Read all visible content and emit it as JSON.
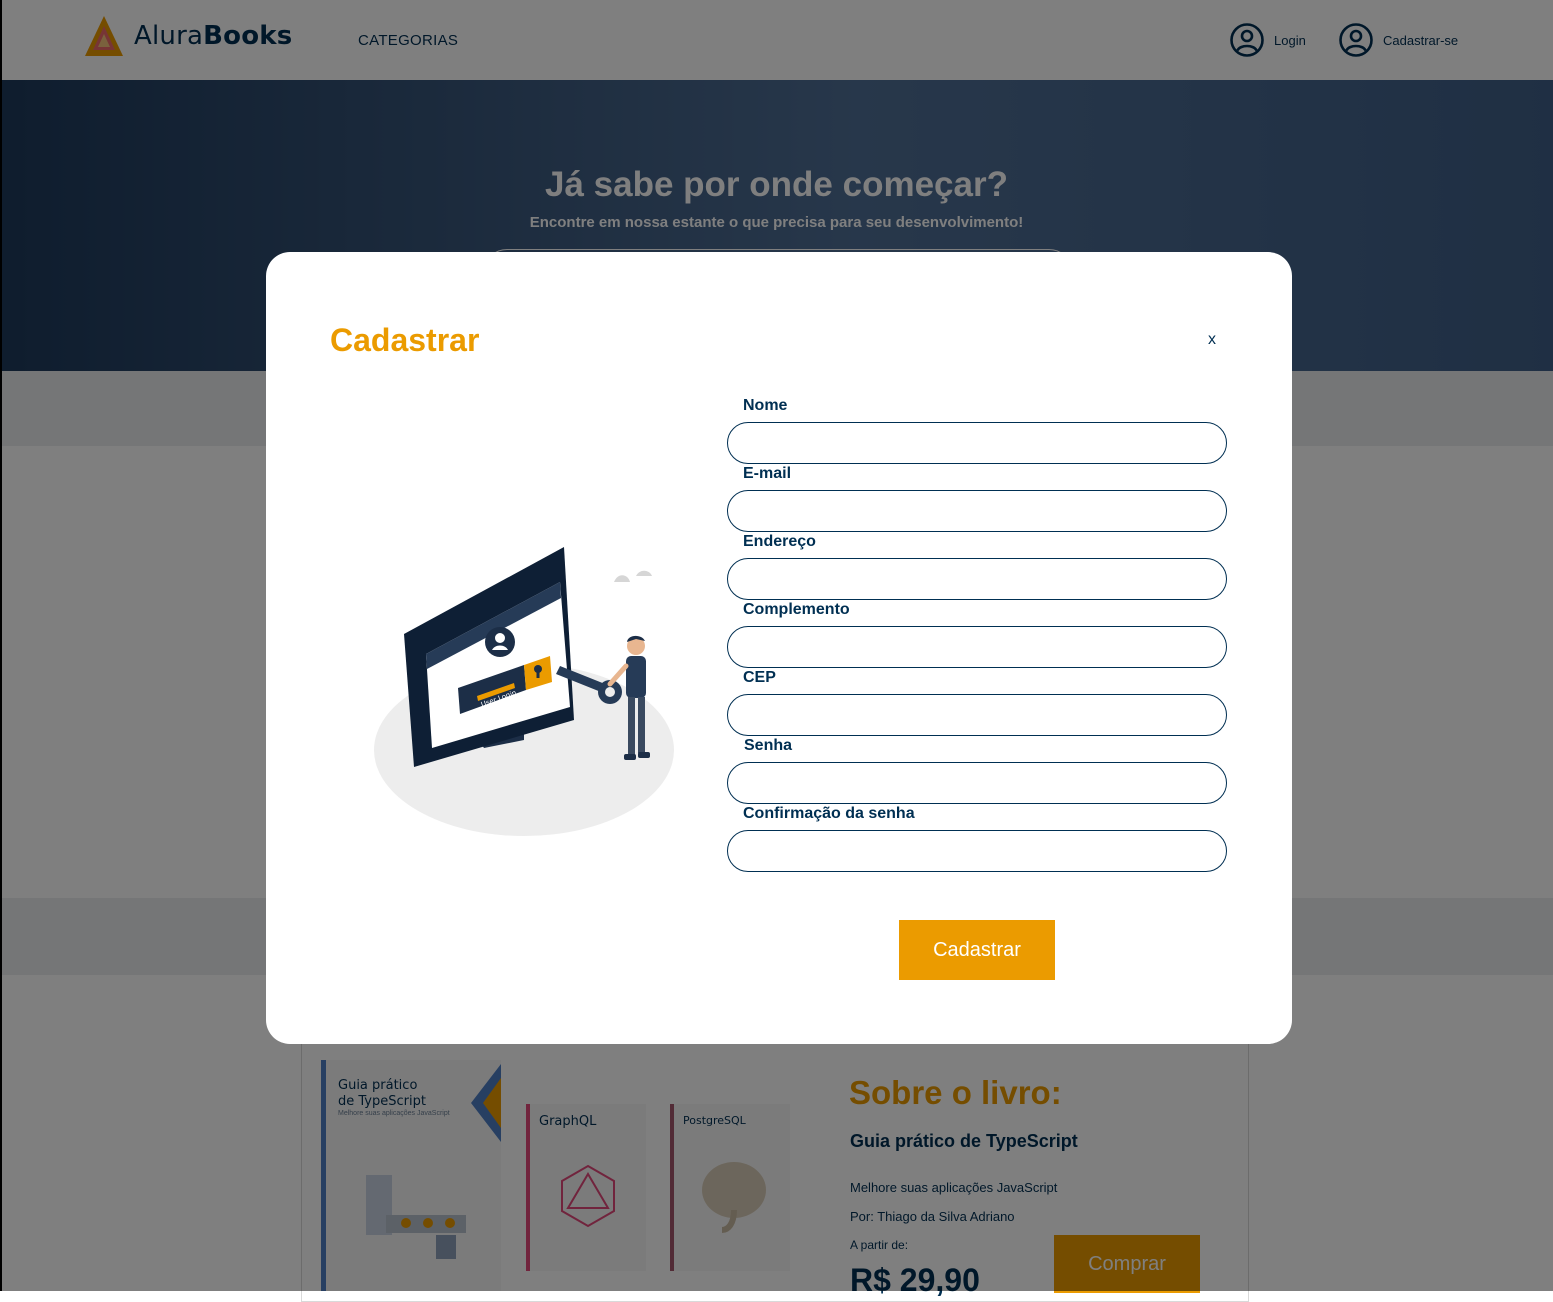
{
  "header": {
    "brand_light": "Alura",
    "brand_bold": "Books",
    "nav_categories": "CATEGORIAS",
    "login": "Login",
    "signup": "Cadastrar-se"
  },
  "hero": {
    "title": "Já sabe por onde começar?",
    "subtitle": "Encontre em nossa estante o que precisa para seu desenvolvimento!"
  },
  "featured": {
    "books": [
      {
        "title_line1": "Guia prático",
        "title_line2": "de TypeScript",
        "tagline": "Melhore suas aplicações JavaScript"
      },
      {
        "title_line1": "GraphQL"
      },
      {
        "title_line1": "PostgreSQL"
      }
    ],
    "about_title": "Sobre o livro:",
    "book_name": "Guia prático de TypeScript",
    "description": "Melhore suas aplicações JavaScript",
    "author": "Por: Thiago da Silva Adriano",
    "price_from": "A partir de:",
    "price": "R$ 29,90",
    "buy_label": "Comprar"
  },
  "modal": {
    "title": "Cadastrar",
    "close_label": "x",
    "illustration_text": "User Login",
    "fields": [
      {
        "label": "Nome",
        "value": ""
      },
      {
        "label": "E-mail",
        "value": ""
      },
      {
        "label": "Endereço",
        "value": ""
      },
      {
        "label": "Complemento",
        "value": ""
      },
      {
        "label": "CEP",
        "value": ""
      },
      {
        "label": "Senha",
        "value": ""
      },
      {
        "label": "Confirmação da senha",
        "value": ""
      }
    ],
    "submit_label": "Cadastrar"
  },
  "colors": {
    "accent": "#eb9b00",
    "navy": "#002f52",
    "overlay": "rgba(0,0,0,0.5)"
  },
  "icons": {
    "brand": "alura-triangle-logo-icon",
    "login": "user-circle-icon",
    "signup": "user-circle-icon",
    "close": "close-icon"
  }
}
